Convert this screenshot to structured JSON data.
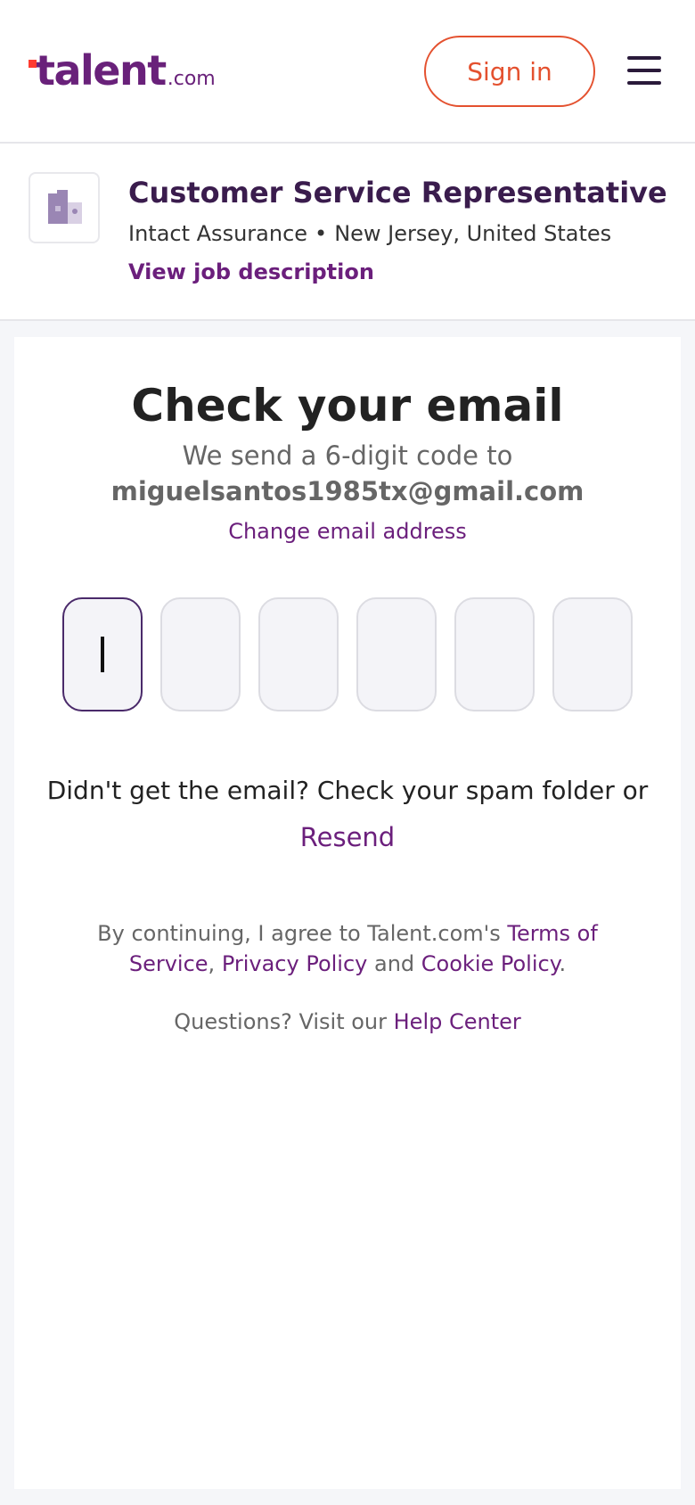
{
  "header": {
    "logo_main": "talent",
    "logo_suffix": ".com",
    "signin_label": "Sign in",
    "menu_icon": "hamburger-menu-icon"
  },
  "job": {
    "title": "Customer Service Representative",
    "company": "Intact Assurance",
    "separator": "•",
    "location": "New Jersey, United States",
    "link_label": "View job description",
    "logo_icon": "building-icon"
  },
  "verify": {
    "heading": "Check your email",
    "subtitle": "We send a 6-digit code to",
    "email": "miguelsantos1985tx@gmail.com",
    "change_label": "Change email address",
    "code_digits": [
      "",
      "",
      "",
      "",
      "",
      ""
    ],
    "didnt_get": "Didn't get the email? Check your spam folder or",
    "resend_label": "Resend"
  },
  "legal": {
    "prefix": "By continuing, I agree to Talent.com's ",
    "terms": "Terms of Service",
    "comma": ", ",
    "privacy": "Privacy Policy",
    "and": " and ",
    "cookie": "Cookie Policy",
    "period": "."
  },
  "help": {
    "prefix": "Questions? Visit our ",
    "link": "Help Center"
  },
  "colors": {
    "brand_purple": "#69217a",
    "accent_orange": "#e4512f"
  }
}
